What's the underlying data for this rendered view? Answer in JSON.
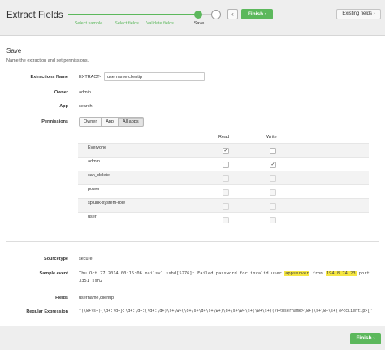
{
  "header": {
    "title": "Extract Fields",
    "steps": [
      "Select sample",
      "Select fields",
      "Validate fields",
      "Save"
    ],
    "back_icon": "‹",
    "finish_label": "Finish ›",
    "existing_fields_label": "Existing fields ›"
  },
  "section": {
    "title": "Save",
    "description": "Name the extraction and set permissions."
  },
  "form": {
    "extraction_name_label": "Extractions Name",
    "extraction_prefix": "EXTRACT-",
    "extraction_name_value": "username,clientip",
    "owner_label": "Owner",
    "owner_value": "admin",
    "app_label": "App",
    "app_value": "search",
    "permissions_label": "Permissions",
    "permission_options": [
      "Owner",
      "App",
      "All apps"
    ],
    "permission_selected": "All apps"
  },
  "permissions_table": {
    "read_header": "Read",
    "write_header": "Write",
    "check_glyph": "✓",
    "rows": [
      {
        "role": "Everyone",
        "read": true,
        "write": false,
        "enabled": true
      },
      {
        "role": "admin",
        "read": false,
        "write": true,
        "enabled": true
      },
      {
        "role": "can_delete",
        "read": false,
        "write": false,
        "enabled": false
      },
      {
        "role": "power",
        "read": false,
        "write": false,
        "enabled": false
      },
      {
        "role": "splunk-system-role",
        "read": false,
        "write": false,
        "enabled": false
      },
      {
        "role": "user",
        "read": false,
        "write": false,
        "enabled": false
      }
    ]
  },
  "details": {
    "sourcetype_label": "Sourcetype",
    "sourcetype_value": "secure",
    "sample_event_label": "Sample event",
    "sample_event_before": "Thu Oct 27 2014 00:15:06 mailsv1 sshd[5276]: Failed password for invalid user ",
    "sample_event_user": "appserver",
    "sample_event_middle": " from ",
    "sample_event_ip": "194.8.74.23",
    "sample_event_after": " port 3351 ssh2",
    "fields_label": "Fields",
    "fields_value": "username,clientip",
    "regex_label": "Regular Expression",
    "regex_value": "^(\\w+\\s+){\\d+:\\d+}:\\d+:\\d+:(\\d+:\\d+)\\s+\\w+(\\d+\\s+\\d+\\s+\\w+)\\d+\\s+\\w+\\s+(\\w+\\s+)(?P<username>\\w+)\\s+\\w+\\s+(?P<clientip>[^ ]+)"
  },
  "footer": {
    "finish_label": "Finish ›"
  },
  "colors": {
    "accent_green": "#5cb85c",
    "highlight_yellow": "#f5e642"
  }
}
